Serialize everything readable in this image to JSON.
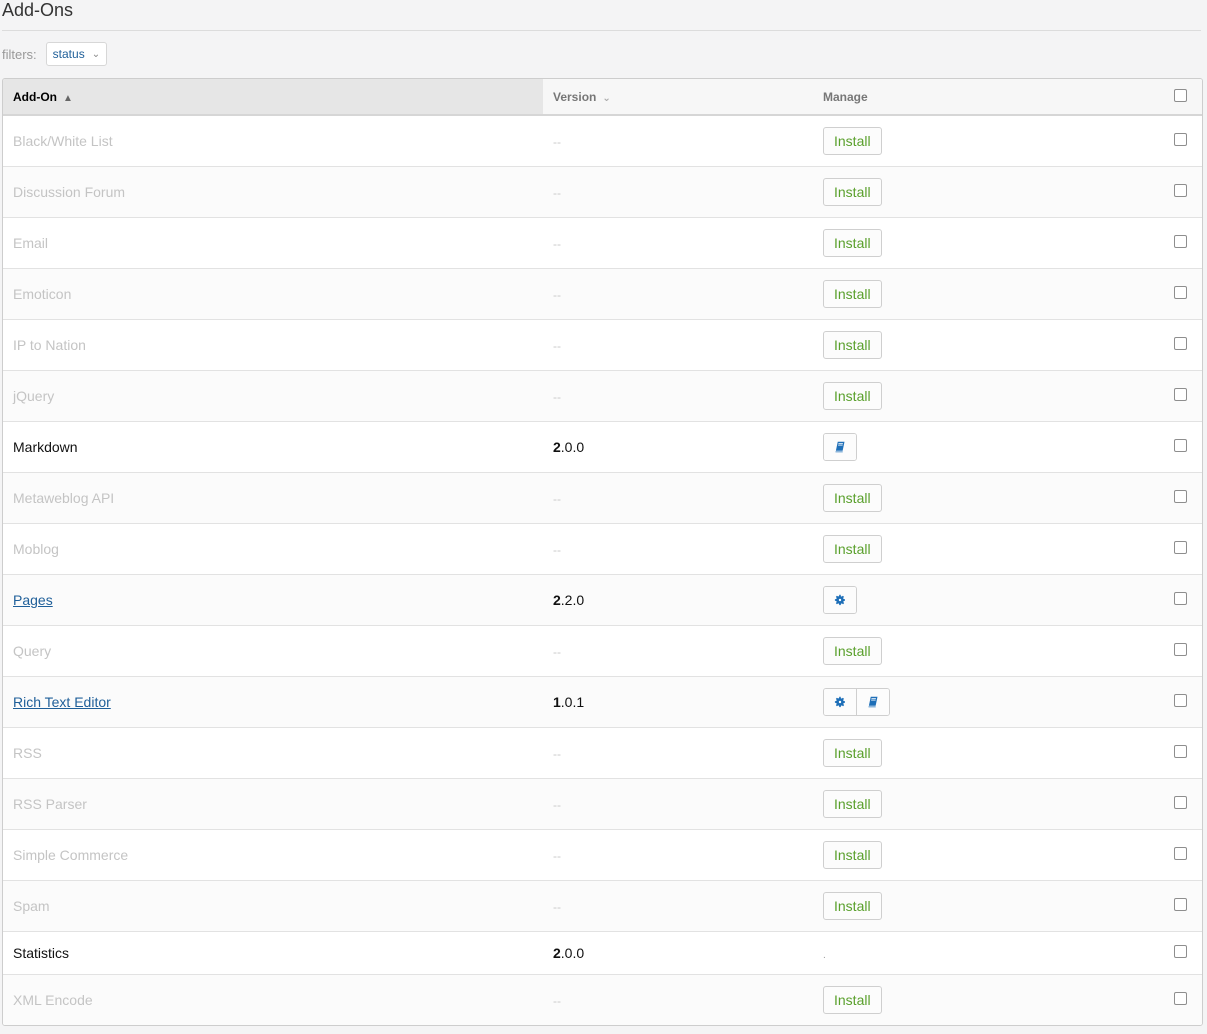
{
  "page": {
    "title": "Add-Ons"
  },
  "filters": {
    "label": "filters:",
    "status_select": "status"
  },
  "table": {
    "columns": {
      "addon": "Add-On",
      "version": "Version",
      "manage": "Manage"
    },
    "rows": [
      {
        "name": "Black/White List",
        "state": "disabled",
        "version": "--",
        "action": "Install"
      },
      {
        "name": "Discussion Forum",
        "state": "disabled",
        "version": "--",
        "action": "Install"
      },
      {
        "name": "Email",
        "state": "disabled",
        "version": "--",
        "action": "Install"
      },
      {
        "name": "Emoticon",
        "state": "disabled",
        "version": "--",
        "action": "Install"
      },
      {
        "name": "IP to Nation",
        "state": "disabled",
        "version": "--",
        "action": "Install"
      },
      {
        "name": "jQuery",
        "state": "disabled",
        "version": "--",
        "action": "Install"
      },
      {
        "name": "Markdown",
        "state": "installed",
        "version_major": "2",
        "version_rest": ".0.0",
        "actions": [
          "book-icon"
        ]
      },
      {
        "name": "Metaweblog API",
        "state": "disabled",
        "version": "--",
        "action": "Install"
      },
      {
        "name": "Moblog",
        "state": "disabled",
        "version": "--",
        "action": "Install"
      },
      {
        "name": "Pages",
        "state": "link",
        "version_major": "2",
        "version_rest": ".2.0",
        "actions": [
          "gear-icon"
        ]
      },
      {
        "name": "Query",
        "state": "disabled",
        "version": "--",
        "action": "Install"
      },
      {
        "name": "Rich Text Editor",
        "state": "link",
        "version_major": "1",
        "version_rest": ".0.1",
        "actions": [
          "gear-icon",
          "book-icon"
        ]
      },
      {
        "name": "RSS",
        "state": "disabled",
        "version": "--",
        "action": "Install"
      },
      {
        "name": "RSS Parser",
        "state": "disabled",
        "version": "--",
        "action": "Install"
      },
      {
        "name": "Simple Commerce",
        "state": "disabled",
        "version": "--",
        "action": "Install"
      },
      {
        "name": "Spam",
        "state": "disabled",
        "version": "--",
        "action": "Install"
      },
      {
        "name": "Statistics",
        "state": "installed",
        "version_major": "2",
        "version_rest": ".0.0",
        "manage_text": "."
      },
      {
        "name": "XML Encode",
        "state": "disabled",
        "version": "--",
        "action": "Install"
      }
    ]
  },
  "colors": {
    "link": "#1f5f99",
    "install_text": "#5aa02c",
    "disabled_text": "#c4c4c4"
  }
}
